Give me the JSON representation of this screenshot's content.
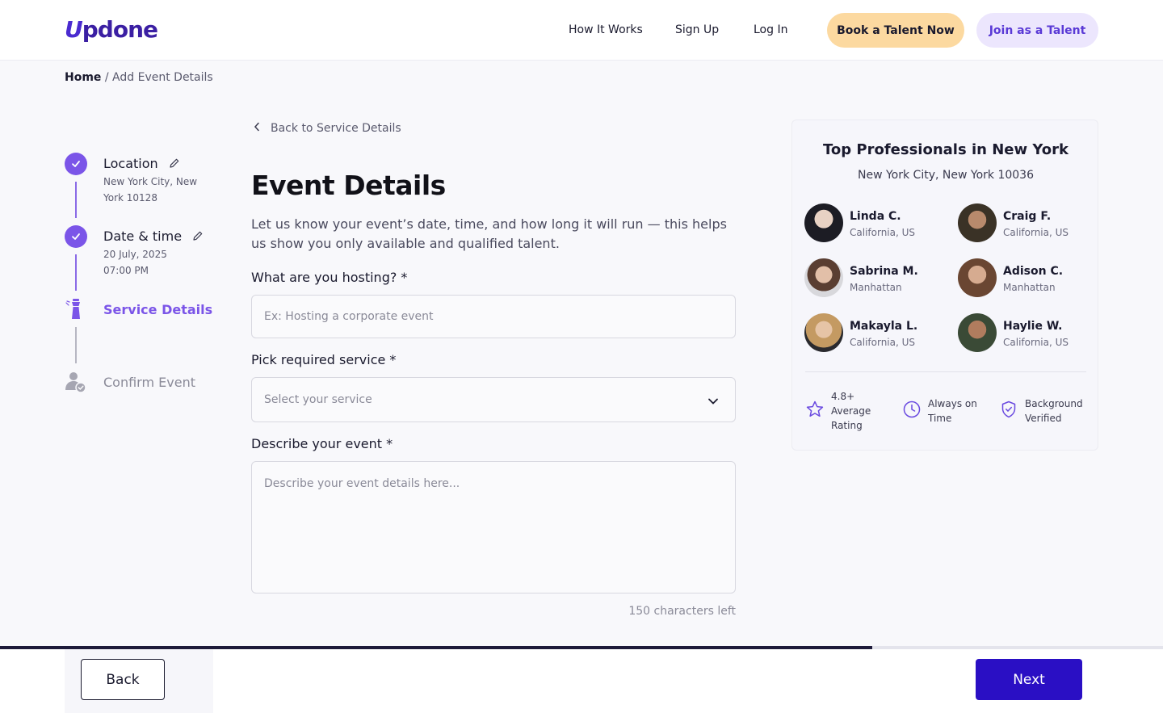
{
  "header": {
    "logo_text": "pdone",
    "logo_mark": "U",
    "nav": [
      "How It Works",
      "Sign Up",
      "Log In"
    ],
    "book_label": "Book a Talent Now",
    "join_label": "Join as a Talent"
  },
  "breadcrumb": {
    "home": "Home",
    "sep": " / ",
    "current": "Add Event Details"
  },
  "steps": [
    {
      "title": "Location",
      "sub": "New York City, New York 10128",
      "status": "done"
    },
    {
      "title": "Date & time",
      "sub_line1": "20 July, 2025",
      "sub_line2": "07:00 PM",
      "status": "done"
    },
    {
      "title": "Service Details",
      "status": "active"
    },
    {
      "title": "Confirm Event",
      "status": "pending"
    }
  ],
  "form": {
    "back_link": "Back to Service Details",
    "title": "Event Details",
    "description": "Let us know your event’s date, time, and how long it will run — this helps us show you only available and qualified talent.",
    "hosting_label": "What are you hosting? *",
    "hosting_placeholder": "Ex: Hosting a corporate event",
    "service_label": "Pick required service *",
    "service_placeholder": "Select your service",
    "describe_label": "Describe your event *",
    "describe_placeholder": "Describe your event details here...",
    "char_count": "150 characters left"
  },
  "card": {
    "title": "Top Professionals in New York",
    "subtitle": "New York City, New York 10036",
    "pros": [
      {
        "name": "Linda C.",
        "location": "California, US"
      },
      {
        "name": "Craig F.",
        "location": "California, US"
      },
      {
        "name": "Sabrina M.",
        "location": "Manhattan"
      },
      {
        "name": "Adison C.",
        "location": "Manhattan"
      },
      {
        "name": "Makayla L.",
        "location": "California, US"
      },
      {
        "name": "Haylie W.",
        "location": "California, US"
      }
    ],
    "features": [
      {
        "line1": "4.8+",
        "line2": "Average",
        "line3": "Rating",
        "icon": "star-icon"
      },
      {
        "line1": "Always on",
        "line2": "Time",
        "icon": "clock-icon"
      },
      {
        "line1": "Background",
        "line2": "Verified",
        "icon": "shield-check-icon"
      }
    ]
  },
  "footer": {
    "back_label": "Back",
    "next_label": "Next",
    "progress": 0.75
  },
  "colors": {
    "accent": "#7b55e8",
    "primary": "#2a0fc4",
    "book": "#fcd9a0",
    "join": "#ece6fd"
  }
}
